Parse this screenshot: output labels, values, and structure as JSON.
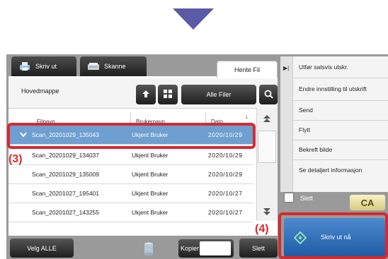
{
  "tabs": {
    "print": "Skriv ut",
    "scan": "Skanne",
    "retrieve": "Hente Fil"
  },
  "folder": {
    "name": "Hovedmappe",
    "filter_button": "Alle Filer"
  },
  "table": {
    "headers": [
      "Filnavn",
      "Brukernavn",
      "Dato"
    ],
    "rows": [
      {
        "name": "Scan_20201029_135043",
        "user": "Ukjent Bruker",
        "date": "2020/10/29",
        "selected": true
      },
      {
        "name": "Scan_20201029_134037",
        "user": "Ukjent Bruker",
        "date": "2020/10/29",
        "selected": false
      },
      {
        "name": "Scan_20201029_135009",
        "user": "Ukjent Bruker",
        "date": "2020/10/29",
        "selected": false
      },
      {
        "name": "Scan_20201027_195401",
        "user": "Ukjent Bruker",
        "date": "2020/10/27",
        "selected": false
      },
      {
        "name": "Scan_20201027_143255",
        "user": "Ukjent Bruker",
        "date": "2020/10/27",
        "selected": false
      }
    ]
  },
  "bottom": {
    "select_all": "Velg ALLE",
    "copies_label": "Kopier",
    "copies_value": "",
    "delete": "Slett"
  },
  "menu": {
    "items": [
      "Utfør satsvis utskr.",
      "Endre innstilling til utskrift",
      "Send",
      "Flytt",
      "Bekreft bilde",
      "Se detaljert informasjon"
    ],
    "delete_checkbox": "Slett",
    "ca_button": "CA",
    "print_now": "Skriv ut nå"
  },
  "steps": {
    "step3": "(3)",
    "step4": "(4)"
  },
  "colors": {
    "accent_arrow": "#5b5aa6",
    "highlight": "#d7282f",
    "selection": "#6f9ed0",
    "print_button": "#2e6db4"
  },
  "icons": [
    "arrow-down-icon",
    "printer-icon",
    "scanner-icon",
    "folder-up-icon",
    "grid-view-icon",
    "search-icon",
    "chevron-down-icon",
    "scroll-top-icon",
    "scroll-bottom-icon",
    "storage-icon",
    "start-diamond-icon",
    "menu-expand-icon"
  ]
}
